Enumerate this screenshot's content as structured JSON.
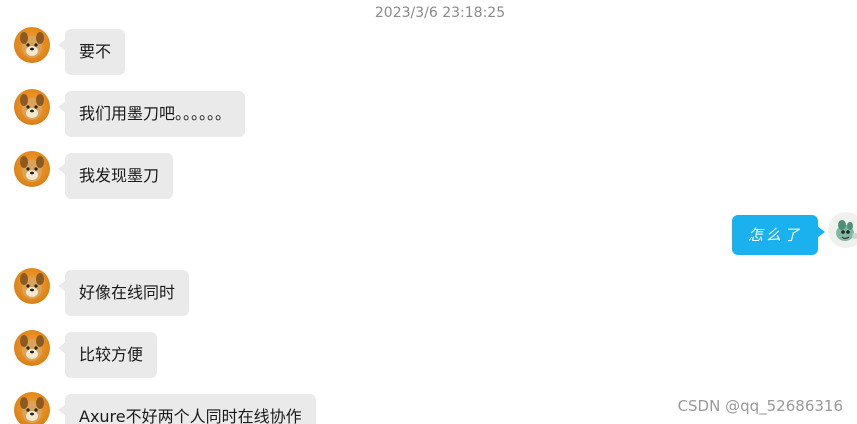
{
  "timestamp": "2023/3/6 23:18:25",
  "messages": [
    {
      "side": "left",
      "text": "要不"
    },
    {
      "side": "left",
      "text": "我们用墨刀吧。。。。。。"
    },
    {
      "side": "left",
      "text": "我发现墨刀"
    },
    {
      "side": "right",
      "text": "怎么了"
    },
    {
      "side": "left",
      "text": "好像在线同时"
    },
    {
      "side": "left",
      "text": "比较方便"
    },
    {
      "side": "left",
      "text": "Axure不好两个人同时在线协作"
    }
  ],
  "watermark": "CSDN @qq_52686316",
  "colors": {
    "left_bubble": "#eaeaea",
    "right_bubble": "#19b2ee",
    "timestamp": "#8a8a8a"
  },
  "icons": {
    "contact_avatar": "dog-avatar",
    "self_avatar": "cartoon-avatar"
  }
}
